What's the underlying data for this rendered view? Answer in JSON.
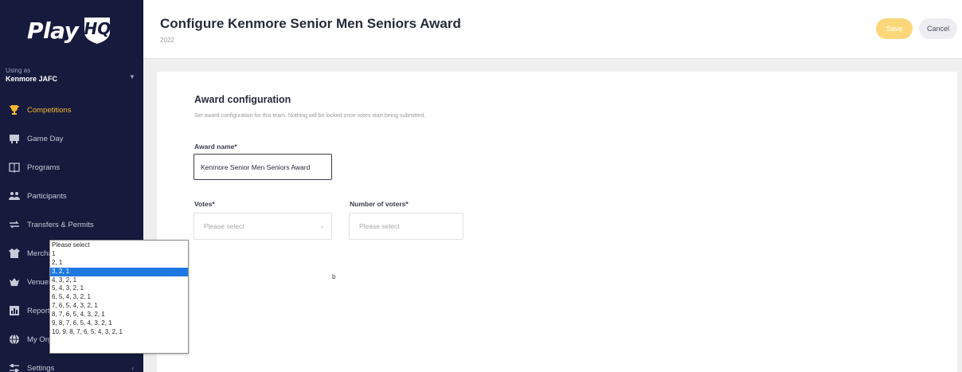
{
  "sidebar": {
    "logo_text": "Play",
    "logo_badge": "HQ",
    "using_as_label": "Using as",
    "org_name": "Kenmore JAFC",
    "items": [
      {
        "label": "Competitions",
        "icon": "trophy-icon",
        "active": true,
        "has_chevron": false
      },
      {
        "label": "Game Day",
        "icon": "scoreboard-icon",
        "active": false,
        "has_chevron": false
      },
      {
        "label": "Programs",
        "icon": "book-icon",
        "active": false,
        "has_chevron": false
      },
      {
        "label": "Participants",
        "icon": "people-icon",
        "active": false,
        "has_chevron": false
      },
      {
        "label": "Transfers & Permits",
        "icon": "arrows-icon",
        "active": false,
        "has_chevron": false
      },
      {
        "label": "Merchandise",
        "icon": "shirt-icon",
        "active": false,
        "has_chevron": true
      },
      {
        "label": "Venues",
        "icon": "stadium-icon",
        "active": false,
        "has_chevron": false
      },
      {
        "label": "Reports",
        "icon": "chart-icon",
        "active": false,
        "has_chevron": false
      },
      {
        "label": "My Organisation",
        "icon": "globe-icon",
        "active": false,
        "has_chevron": true
      },
      {
        "label": "Settings",
        "icon": "sliders-icon",
        "active": false,
        "has_chevron": true
      }
    ]
  },
  "header": {
    "title": "Configure Kenmore Senior Men Seniors Award",
    "subtitle": "2022",
    "save_label": "Save",
    "cancel_label": "Cancel"
  },
  "form": {
    "section_title": "Award configuration",
    "section_description": "Set award configuration for this team. Nothing will be locked once votes start being submitted.",
    "award_name_label": "Award name*",
    "award_name_value": "Kenmore Senior Men Seniors Award",
    "votes_label": "Votes*",
    "votes_placeholder": "Please select",
    "voters_label": "Number of voters*",
    "voters_placeholder": "Please select",
    "hidden_fragment": "b"
  },
  "votes_dropdown": {
    "selected_index": 3,
    "options": [
      "Please select",
      "1",
      "2, 1",
      "3, 2, 1",
      "4, 3, 2, 1",
      "5, 4, 3, 2, 1",
      "6, 5, 4, 3, 2, 1",
      "7, 6, 5, 4, 3, 2, 1",
      "8, 7, 6, 5, 4, 3, 2, 1",
      "9, 8, 7, 6, 5, 4, 3, 2, 1",
      "10, 9, 8, 7, 6, 5, 4, 3, 2, 1"
    ]
  },
  "colors": {
    "sidebar_bg": "#161a3d",
    "accent": "#f5b731",
    "save_button": "#fbd77a",
    "selected_option": "#1e78e0"
  }
}
